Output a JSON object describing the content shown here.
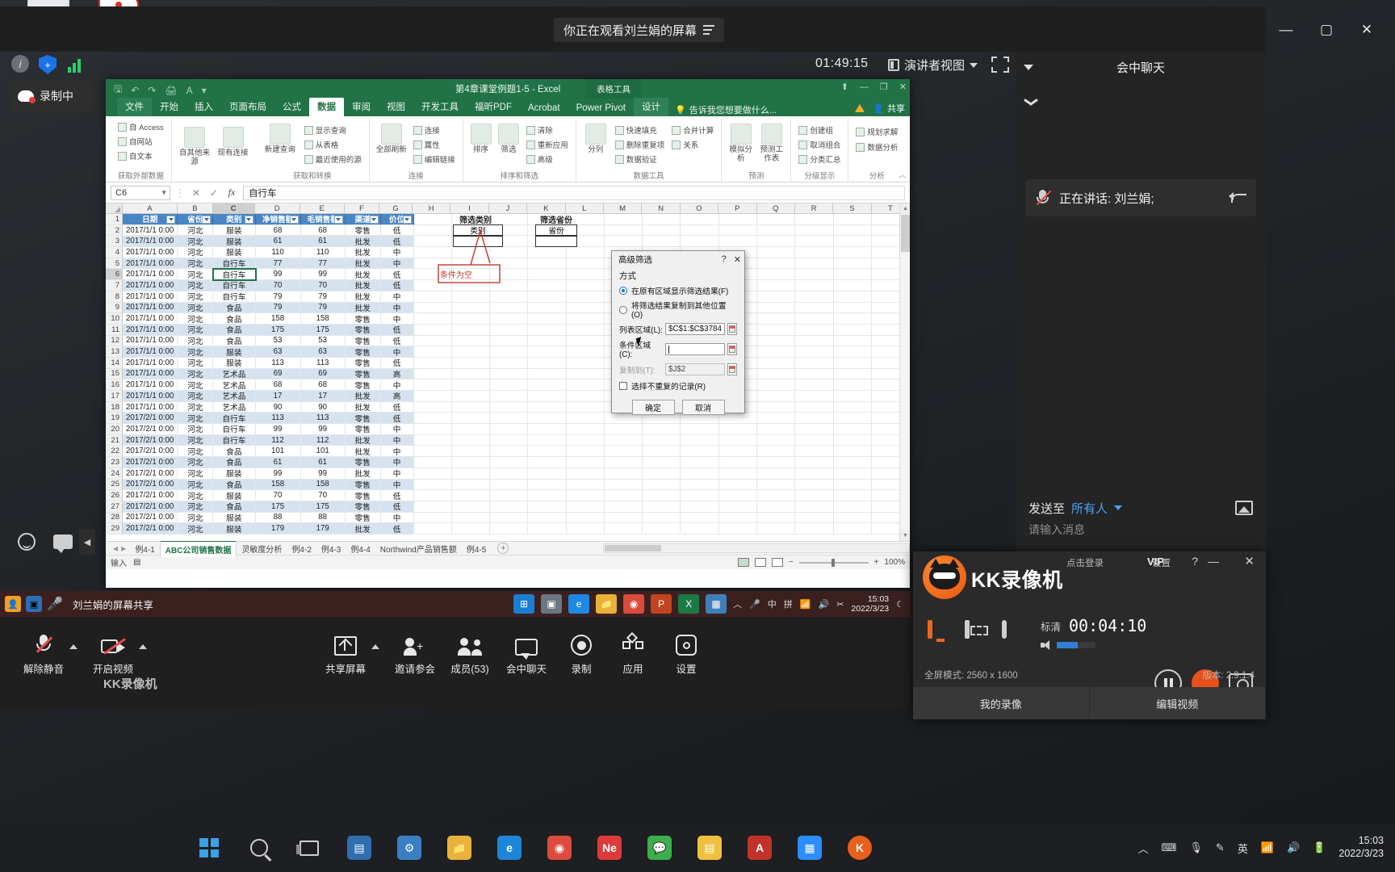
{
  "meeting": {
    "title": "你正在观看刘兰娟的屏幕",
    "menu_icon": "hamburger-icon",
    "timer": "01:49:15",
    "presenter_view": "演讲者视图",
    "recording_badge": "录制中",
    "window_controls": {
      "minimize": "—",
      "maximize": "▢",
      "close": "✕"
    }
  },
  "chat_panel": {
    "title": "会中聊天",
    "speaking_label": "正在讲话: 刘兰娟;",
    "send_to_label": "发送至",
    "send_to_value": "所有人",
    "input_placeholder": "请输入消息"
  },
  "excel": {
    "title": "第4章课堂例题1-5 - Excel",
    "table_tools": "表格工具",
    "share_label": "共享",
    "tabs": [
      "文件",
      "开始",
      "插入",
      "页面布局",
      "公式",
      "数据",
      "审阅",
      "视图",
      "开发工具",
      "福昕PDF",
      "Acrobat",
      "Power Pivot",
      "设计"
    ],
    "active_tab": "数据",
    "tell_me": "告诉我您想要做什么...",
    "ribbon_groups": [
      {
        "label": "获取外部数据",
        "items": [
          "自 Access",
          "自网站",
          "自文本",
          "自其他来源",
          "现有连接"
        ]
      },
      {
        "label": "获取和转换",
        "items": [
          "新建查询",
          "显示查询",
          "从表格",
          "最近使用的源"
        ]
      },
      {
        "label": "连接",
        "items": [
          "全部刷新",
          "连接",
          "属性",
          "编辑链接"
        ]
      },
      {
        "label": "排序和筛选",
        "items": [
          "排序",
          "筛选",
          "清除",
          "重新应用",
          "高级"
        ]
      },
      {
        "label": "数据工具",
        "items": [
          "分列",
          "快速填充",
          "删除重复项",
          "数据验证",
          "合并计算",
          "关系"
        ]
      },
      {
        "label": "预测",
        "items": [
          "模拟分析",
          "预测工作表"
        ]
      },
      {
        "label": "分级显示",
        "items": [
          "创建组",
          "取消组合",
          "分类汇总"
        ]
      },
      {
        "label": "分析",
        "items": [
          "规划求解",
          "数据分析"
        ]
      }
    ],
    "name_box": "C6",
    "formula_value": "自行车",
    "columns": [
      "A",
      "B",
      "C",
      "D",
      "E",
      "F",
      "G",
      "H",
      "I",
      "J",
      "K",
      "L",
      "M",
      "N",
      "O",
      "P",
      "Q",
      "R",
      "S",
      "T"
    ],
    "selected_column": "C",
    "selected_row": 6,
    "headers": [
      "日期",
      "省份",
      "类别",
      "净销售额",
      "毛销售额",
      "渠道",
      "价位"
    ],
    "rows": [
      [
        "2017/1/1 0:00",
        "河北",
        "服装",
        "68",
        "68",
        "零售",
        "低"
      ],
      [
        "2017/1/1 0:00",
        "河北",
        "服装",
        "61",
        "61",
        "批发",
        "低"
      ],
      [
        "2017/1/1 0:00",
        "河北",
        "服装",
        "110",
        "110",
        "批发",
        "中"
      ],
      [
        "2017/1/1 0:00",
        "河北",
        "自行车",
        "77",
        "77",
        "批发",
        "中"
      ],
      [
        "2017/1/1 0:00",
        "河北",
        "自行车",
        "99",
        "99",
        "批发",
        "低"
      ],
      [
        "2017/1/1 0:00",
        "河北",
        "自行车",
        "70",
        "70",
        "批发",
        "低"
      ],
      [
        "2017/1/1 0:00",
        "河北",
        "自行车",
        "79",
        "79",
        "批发",
        "中"
      ],
      [
        "2017/1/1 0:00",
        "河北",
        "食品",
        "79",
        "79",
        "批发",
        "中"
      ],
      [
        "2017/1/1 0:00",
        "河北",
        "食品",
        "158",
        "158",
        "零售",
        "中"
      ],
      [
        "2017/1/1 0:00",
        "河北",
        "食品",
        "175",
        "175",
        "零售",
        "低"
      ],
      [
        "2017/1/1 0:00",
        "河北",
        "食品",
        "53",
        "53",
        "零售",
        "低"
      ],
      [
        "2017/1/1 0:00",
        "河北",
        "服装",
        "63",
        "63",
        "零售",
        "中"
      ],
      [
        "2017/1/1 0:00",
        "河北",
        "服装",
        "113",
        "113",
        "零售",
        "低"
      ],
      [
        "2017/1/1 0:00",
        "河北",
        "艺术品",
        "69",
        "69",
        "零售",
        "高"
      ],
      [
        "2017/1/1 0:00",
        "河北",
        "艺术品",
        "68",
        "68",
        "零售",
        "中"
      ],
      [
        "2017/1/1 0:00",
        "河北",
        "艺术品",
        "17",
        "17",
        "批发",
        "高"
      ],
      [
        "2017/1/1 0:00",
        "河北",
        "艺术品",
        "90",
        "90",
        "批发",
        "低"
      ],
      [
        "2017/2/1 0:00",
        "河北",
        "自行车",
        "113",
        "113",
        "零售",
        "低"
      ],
      [
        "2017/2/1 0:00",
        "河北",
        "自行车",
        "99",
        "99",
        "零售",
        "中"
      ],
      [
        "2017/2/1 0:00",
        "河北",
        "自行车",
        "112",
        "112",
        "批发",
        "中"
      ],
      [
        "2017/2/1 0:00",
        "河北",
        "食品",
        "101",
        "101",
        "批发",
        "中"
      ],
      [
        "2017/2/1 0:00",
        "河北",
        "食品",
        "61",
        "61",
        "零售",
        "中"
      ],
      [
        "2017/2/1 0:00",
        "河北",
        "服装",
        "99",
        "99",
        "批发",
        "中"
      ],
      [
        "2017/2/1 0:00",
        "河北",
        "食品",
        "158",
        "158",
        "零售",
        "中"
      ],
      [
        "2017/2/1 0:00",
        "河北",
        "服装",
        "70",
        "70",
        "零售",
        "低"
      ],
      [
        "2017/2/1 0:00",
        "河北",
        "食品",
        "175",
        "175",
        "零售",
        "低"
      ],
      [
        "2017/2/1 0:00",
        "河北",
        "服装",
        "88",
        "88",
        "零售",
        "中"
      ],
      [
        "2017/2/1 0:00",
        "河北",
        "服装",
        "179",
        "179",
        "批发",
        "低"
      ]
    ],
    "annotations": {
      "criteria_cat_title": "筛选类别",
      "criteria_cat_field": "类别",
      "criteria_prov_title": "筛选省份",
      "criteria_prov_field": "省份",
      "ink_note": "条件为空"
    },
    "sheet_tabs": [
      "例4-1",
      "ABC公司销售数据",
      "灵敏度分析",
      "例4-2",
      "例4-3",
      "例4-4",
      "Northwind产品销售额",
      "例4-5"
    ],
    "active_sheet": "ABC公司销售数据",
    "status_left": "输入",
    "zoom_level": "100%"
  },
  "dialog": {
    "title": "高级筛选",
    "help_icon": "?",
    "close_icon": "✕",
    "section_label": "方式",
    "radio_in_place": "在原有区域显示筛选结果(F)",
    "radio_copy_to": "将筛选结果复制到其他位置(O)",
    "list_range_label": "列表区域(L):",
    "list_range_value": "$C$1:$C$3784",
    "criteria_range_label": "条件区域(C):",
    "criteria_range_value": "",
    "copy_to_label": "复制到(T):",
    "copy_to_value": "$J$2",
    "unique_checkbox": "选择不重复的记录(R)",
    "ok_button": "确定",
    "cancel_button": "取消"
  },
  "kk_recorder": {
    "login": "点击登录",
    "vip": "VIP",
    "settings": "设置",
    "help_icon": "?",
    "minimize_icon": "—",
    "close_icon": "✕",
    "app_name": "KK录像机",
    "quality": "标清",
    "elapsed": "00:04:10",
    "fullscreen_mode": "全屏模式: 2560 x 1600",
    "version": "版本: 2.9.1.4",
    "my_recordings": "我的录像",
    "edit_video": "编辑视频"
  },
  "zoom_toolbar": {
    "mute_label": "解除静音",
    "video_label": "开启视频",
    "watermark": "KK录像机",
    "items": [
      {
        "label": "共享屏幕",
        "icon": "share-screen-icon"
      },
      {
        "label": "邀请参会",
        "icon": "invite-icon"
      },
      {
        "label": "成员(53)",
        "icon": "participants-icon"
      },
      {
        "label": "会中聊天",
        "icon": "chat-icon"
      },
      {
        "label": "录制",
        "icon": "record-icon"
      },
      {
        "label": "应用",
        "icon": "apps-icon"
      },
      {
        "label": "设置",
        "icon": "settings-icon"
      }
    ]
  },
  "inner_taskbar": {
    "share_title": "刘兰娟的屏幕共享",
    "ime": "中",
    "pinyin": "拼",
    "time": "15:03",
    "date": "2022/3/23"
  },
  "outer_taskbar": {
    "ime_lang": "英",
    "time": "15:03",
    "date": "2022/3/23"
  }
}
